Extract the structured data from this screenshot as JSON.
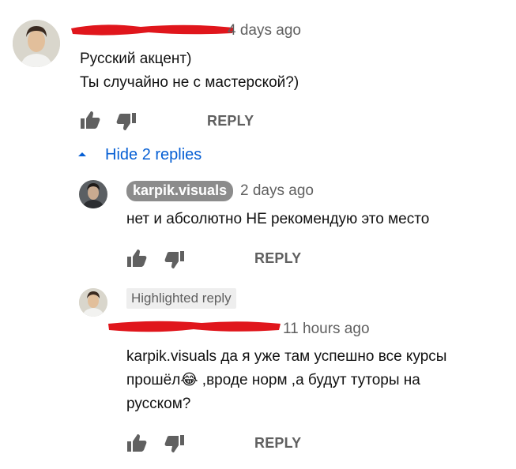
{
  "comment": {
    "author_redacted": true,
    "time": "4 days ago",
    "lines": [
      "Русский акцент)",
      "Ты случайно не с мастерской?)"
    ],
    "reply_label": "REPLY"
  },
  "replies_toggle": {
    "label": "Hide 2 replies"
  },
  "replies": [
    {
      "author": "karpik.visuals",
      "time": "2 days ago",
      "text": "нет и абсолютно НЕ рекомендую это место",
      "reply_label": "REPLY"
    },
    {
      "badge": "Highlighted reply",
      "author_redacted": true,
      "time": "11 hours ago",
      "lines": [
        "karpik.visuals да я уже там успешно все курсы",
        "прошёл",
        " ,вроде норм ,а будут туторы на",
        "русском?"
      ],
      "emoji": "😂",
      "reply_label": "REPLY"
    }
  ],
  "colors": {
    "link_blue": "#065fd4",
    "meta_gray": "#606060",
    "redaction_red": "#e0161c",
    "chip_gray": "#8c8c8c"
  },
  "icons": [
    "thumb-up-icon",
    "thumb-down-icon",
    "chevron-up-icon"
  ]
}
